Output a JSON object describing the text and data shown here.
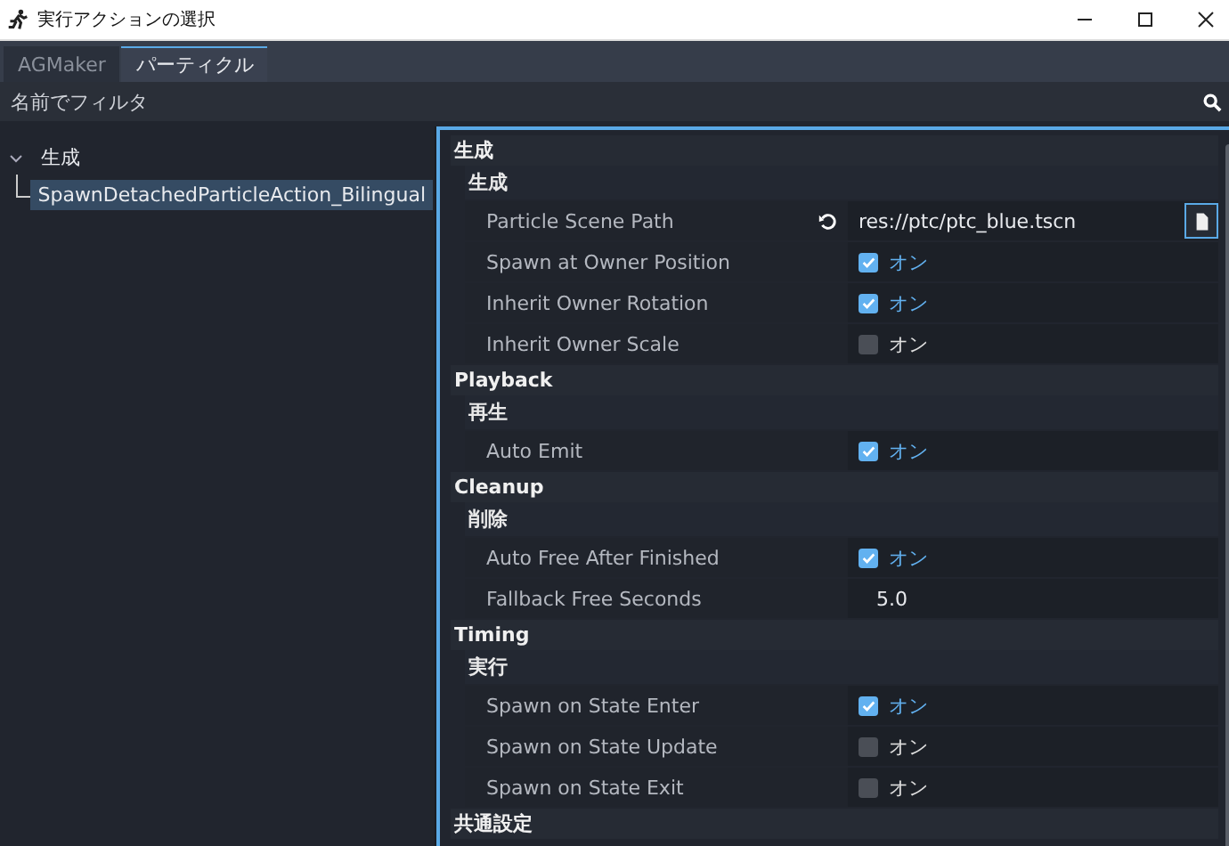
{
  "window": {
    "title": "実行アクションの選択"
  },
  "tabs": [
    {
      "label": "AGMaker",
      "selected": false
    },
    {
      "label": "パーティクル",
      "selected": true
    }
  ],
  "filter": {
    "placeholder": "名前でフィルタ"
  },
  "tree": {
    "items": [
      {
        "label": "生成",
        "expanded": true,
        "selected": false,
        "children": [
          {
            "label": "SpawnDetachedParticleAction_Bilingual",
            "selected": true
          }
        ]
      }
    ]
  },
  "inspector": {
    "sections": [
      {
        "title": "生成",
        "groups": [
          {
            "title": "生成",
            "props": [
              {
                "kind": "path",
                "label": "Particle Scene Path",
                "value": "res://ptc/ptc_blue.tscn"
              },
              {
                "kind": "check",
                "label": "Spawn at Owner Position",
                "checked": true,
                "text": "オン"
              },
              {
                "kind": "check",
                "label": "Inherit Owner Rotation",
                "checked": true,
                "text": "オン"
              },
              {
                "kind": "check",
                "label": "Inherit Owner Scale",
                "checked": false,
                "text": "オン"
              }
            ]
          }
        ]
      },
      {
        "title": "Playback",
        "groups": [
          {
            "title": "再生",
            "props": [
              {
                "kind": "check",
                "label": "Auto Emit",
                "checked": true,
                "text": "オン"
              }
            ]
          }
        ]
      },
      {
        "title": "Cleanup",
        "groups": [
          {
            "title": "削除",
            "props": [
              {
                "kind": "check",
                "label": "Auto Free After Finished",
                "checked": true,
                "text": "オン"
              },
              {
                "kind": "number",
                "label": "Fallback Free Seconds",
                "value": "5.0"
              }
            ]
          }
        ]
      },
      {
        "title": "Timing",
        "groups": [
          {
            "title": "実行",
            "props": [
              {
                "kind": "check",
                "label": "Spawn on State Enter",
                "checked": true,
                "text": "オン"
              },
              {
                "kind": "check",
                "label": "Spawn on State Update",
                "checked": false,
                "text": "オン"
              },
              {
                "kind": "check",
                "label": "Spawn on State Exit",
                "checked": false,
                "text": "オン"
              }
            ]
          }
        ]
      },
      {
        "title": "共通設定"
      }
    ]
  }
}
